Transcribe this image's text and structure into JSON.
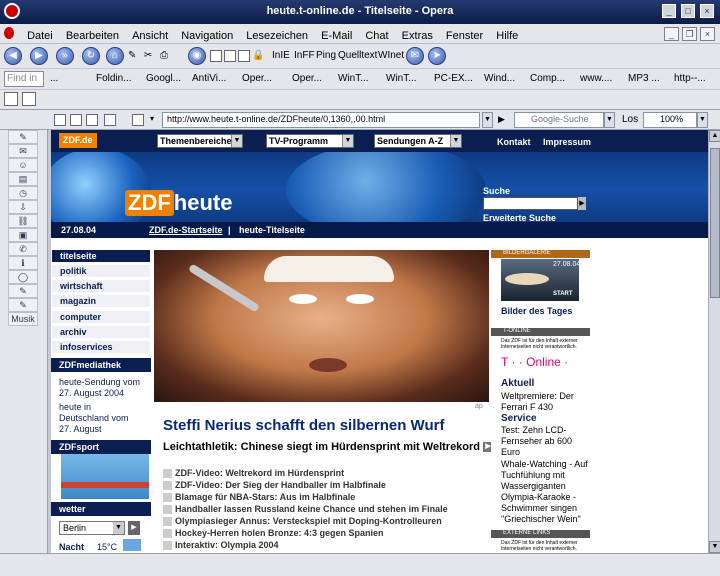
{
  "window": {
    "title": "heute.t-online.de - Titelseite - Opera"
  },
  "menu": [
    "Datei",
    "Bearbeiten",
    "Ansicht",
    "Navigation",
    "Lesezeichen",
    "E-Mail",
    "Chat",
    "Extras",
    "Fenster",
    "Hilfe"
  ],
  "nav_toolbar": {
    "items": [
      "InIE",
      "InFF",
      "Ping",
      "Quelltext",
      "WInet"
    ]
  },
  "find_placeholder": "Find in",
  "bookmarks": [
    "...",
    "Foldin...",
    "Googl...",
    "AntiVi...",
    "Oper...",
    "Oper...",
    "WinT...",
    "WinT...",
    "PC-EX...",
    "Wind...",
    "Comp...",
    "www....",
    "MP3 ...",
    "http--..."
  ],
  "address_bar": {
    "url": "http://www.heute.t-online.de/ZDFheute/0,1360,,00.html",
    "search_placeholder": "Google-Suche",
    "los_label": "Los",
    "zoom": "100%"
  },
  "panel": {
    "label": "Musik"
  },
  "site": {
    "logo": "ZDF.de",
    "dropdowns": [
      "Themenbereiche",
      "TV-Programm",
      "Sendungen A-Z"
    ],
    "header_links": [
      "Kontakt",
      "Impressum"
    ],
    "brand_z": "ZDF",
    "brand_rest": "heute",
    "search_label": "Suche",
    "advanced_search": "Erweiterte Suche",
    "date": "27.08.04",
    "breadcrumb_home": "ZDF.de-Startseite",
    "breadcrumb_sep": "|",
    "breadcrumb_current": "heute-Titelseite",
    "left_nav": [
      "titelseite",
      "politik",
      "wirtschaft",
      "magazin",
      "computer",
      "archiv",
      "infoservices"
    ],
    "mediathek": {
      "title": "ZDFmediathek",
      "items": [
        "heute-Sendung vom 27. August 2004",
        "heute in Deutschland vom 27. August"
      ]
    },
    "zdfsport": "ZDFsport",
    "weather": {
      "title": "wetter",
      "city": "Berlin",
      "night_label": "Nacht",
      "night_temp": "15°C"
    },
    "photo_credit": "ap",
    "headline": "Steffi Nerius schafft den silbernen Wurf",
    "subheadline": "Leichtathletik: Chinese siegt im Hürdensprint mit Weltrekord",
    "news": [
      "ZDF-Video: Weltrekord im Hürdensprint",
      "ZDF-Video: Der Sieg der Handballer im Halbfinale",
      "Blamage für NBA-Stars: Aus im Halbfinale",
      "Handballer lassen Russland keine Chance und stehen im Finale",
      "Olympiasieger Annus: Versteckspiel mit Doping-Kontrolleuren",
      "Hockey-Herren holen Bronze: 4:3 gegen Spanien",
      "Interaktiv: Olympia 2004"
    ],
    "right": {
      "gallery_head": "BILDERGALERIE",
      "gallery_date": "27.08.04",
      "gallery_start": "START",
      "gallery_title": "Bilder des Tages",
      "tonline_head": "T-ONLINE",
      "disclaimer": "Das ZDF ist für den Inhalt externer Internetseiten nicht verantwortlich.",
      "tonline_logo": "T · · Online ·",
      "aktuell": "Aktuell",
      "aktuell_text": "Weltpremiere: Der Ferrari F 430",
      "service": "Service",
      "service_text": "Test: Zehn LCD-Fernseher ab 600 Euro",
      "item1": "Whale-Watching - Auf Tuchfühlung mit Wassergiganten",
      "item2": "Olympia-Karaoke - Schwimmer singen \"Griechischer Wein\"",
      "extern_head": "EXTERNE LINKS",
      "disclaimer2": "Das ZDF ist für den Inhalt externer Internetseiten nicht verantwortlich."
    }
  }
}
